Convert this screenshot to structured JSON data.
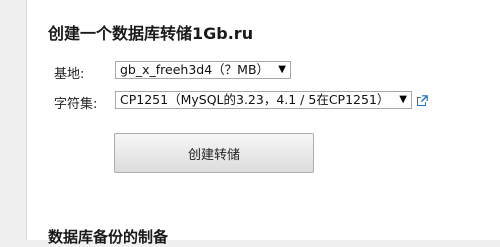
{
  "page": {
    "title": "创建一个数据库转储1Gb.ru",
    "section_title": "数据库备份的制备"
  },
  "form": {
    "base_label": "基地:",
    "base_value": "gb_x_freeh3d4（？MB）",
    "charset_label": "字符集:",
    "charset_value": "CP1251（MySQL的3.23，4.1 / 5在CP1251）",
    "submit_label": "创建转储"
  },
  "icons": {
    "dropdown": "chevron-down-icon",
    "external": "external-link-icon"
  },
  "colors": {
    "link_icon": "#2a6db0"
  }
}
